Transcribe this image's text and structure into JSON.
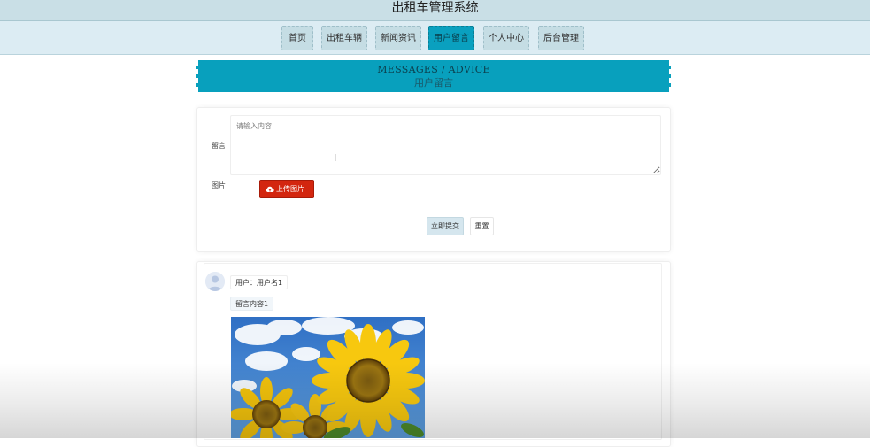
{
  "app": {
    "title": "出租车管理系统"
  },
  "nav": {
    "items": [
      {
        "label": "首页",
        "active": false
      },
      {
        "label": "出租车辆",
        "active": false
      },
      {
        "label": "新闻资讯",
        "active": false
      },
      {
        "label": "用户留言",
        "active": true
      },
      {
        "label": "个人中心",
        "active": false
      },
      {
        "label": "后台管理",
        "active": false
      }
    ]
  },
  "banner": {
    "title_en": "MESSAGES / ADVICE",
    "title_cn": "用户留言"
  },
  "form": {
    "message_label": "留言",
    "message_placeholder": "请输入内容",
    "message_value": "",
    "image_label": "图片",
    "upload_label": "上传图片",
    "submit_label": "立即提交",
    "reset_label": "重置"
  },
  "messages": [
    {
      "user_text": "用户：用户名1",
      "content": "留言内容1",
      "image": "sunflower-photo"
    }
  ],
  "colors": {
    "accent": "#08a0bd",
    "upload": "#d3260f",
    "nav_bg": "#dcecf3",
    "title_bg": "#c9dfe6"
  }
}
